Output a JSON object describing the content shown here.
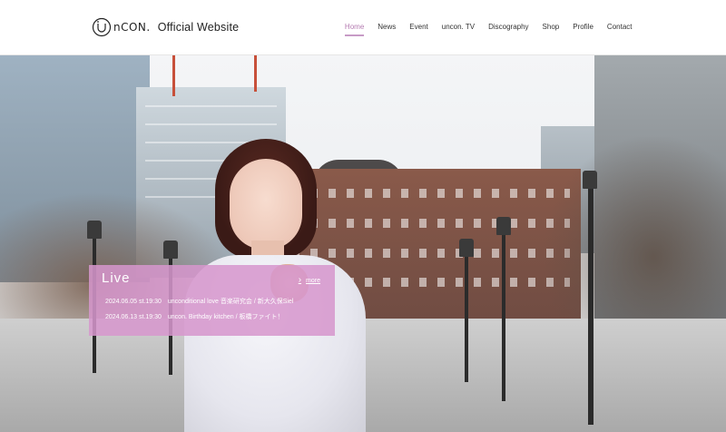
{
  "header": {
    "logo_text": "nCON.",
    "site_title": "Official Website"
  },
  "nav": {
    "items": [
      "Home",
      "News",
      "Event",
      "uncon. TV",
      "Discography",
      "Shop",
      "Profile",
      "Contact"
    ],
    "active": "Home"
  },
  "live": {
    "title": "Live",
    "more_label": "more",
    "events": [
      "2024.06.05 st.19:30　unconditional love 音楽研究会 / 新大久保Siel",
      "2024.06.13 st.19:30　uncon. Birthday kitchen / 板橋ファイト！"
    ]
  },
  "colors": {
    "accent": "#b47bb1",
    "live_panel": "#d696cd"
  }
}
